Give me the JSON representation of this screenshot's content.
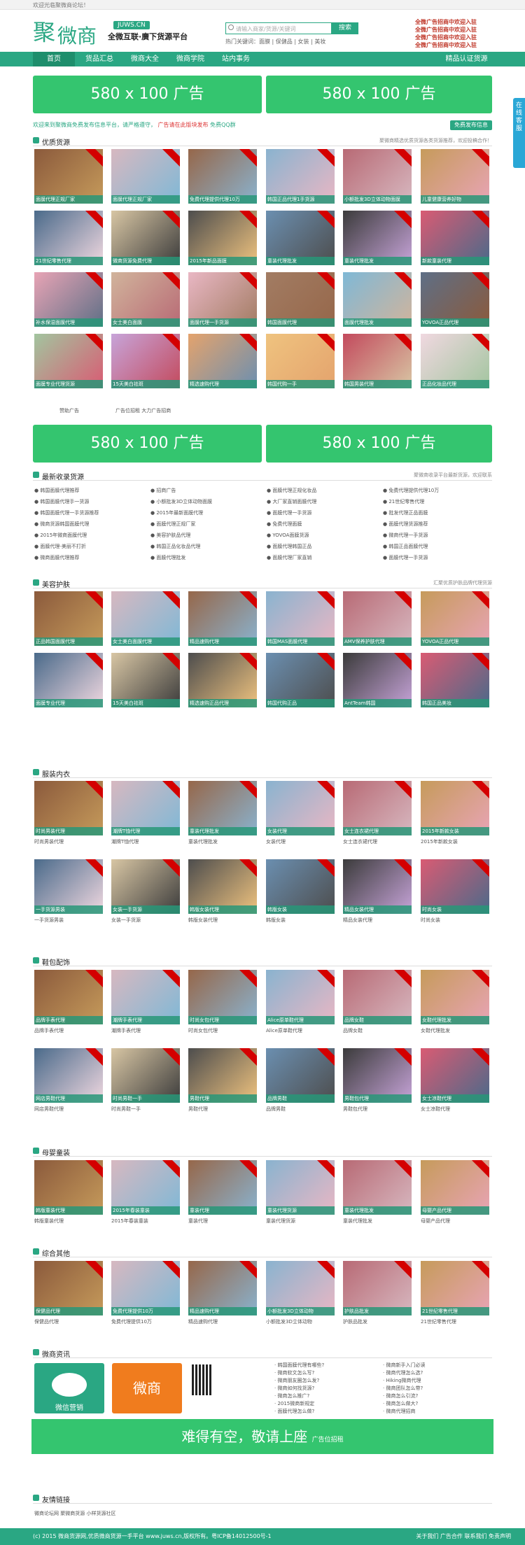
{
  "topbar": {
    "text": "欢迎光临聚微商论坛！"
  },
  "header": {
    "logo_a": "聚",
    "logo_b": "微商",
    "domain": "JUWS.CN",
    "slogan": "全微互联·廣下货源平台",
    "search_placeholder": "请输入商家/货源/关键词",
    "search_button": "搜索",
    "hot": "热门关键词：面膜 | 保健品 | 女装 | 美妆",
    "red_ads": [
      "全微广告招商中欢迎入驻",
      "全微广告招商中欢迎入驻",
      "全微广告招商中欢迎入驻",
      "全微广告招商中欢迎入驻"
    ]
  },
  "nav": [
    "首页",
    "货品汇总",
    "微商大全",
    "微商学院",
    "站内事务",
    "精品认证货源"
  ],
  "banners": [
    "580 x 100 广告",
    "580 x 100 广告"
  ],
  "notice": {
    "a": "欢迎来到聚微商免费发布信息平台，请严格遵守，",
    "b": "广告请在此版块发布",
    "c": "免费QQ群",
    "btn": "免费发布信息"
  },
  "float": "在线客服",
  "sections": {
    "s1": {
      "title": "优质货源",
      "right": "聚微商精选优质货源各类货源推荐，欢迎投稿合作！"
    },
    "s2": {
      "title": "最新收录货源",
      "right": "聚微商收录平台最新货源，欢迎联系"
    },
    "s3": {
      "title": "美容护肤",
      "right": "汇聚优质护肤品牌代理货源"
    },
    "s4": {
      "title": "服装内衣"
    },
    "s5": {
      "title": "鞋包配饰"
    },
    "s6": {
      "title": "母婴童装"
    },
    "s7": {
      "title": "综合其他"
    },
    "s8": {
      "title": "微商资讯"
    },
    "s9": {
      "title": "友情链接"
    }
  },
  "caps1": [
    "面膜代理正规厂家",
    "面膜代理正规厂家",
    "免费代理提供代理10万",
    "韩国正品代理1手货源",
    "小额批发3D立体动物面膜",
    "儿童健康营养好物",
    "21世纪零售代理",
    "微商货源免费代理",
    "2015年新品面膜",
    "童装代理批发",
    "童装代理批发",
    "新款童装代理",
    "补水保湿面膜代理",
    "女士美白面膜",
    "面膜代理一手货源",
    "韩国面膜代理",
    "面膜代理批发",
    "YOVOA正品代理",
    "面膜专业代理货源",
    "15天美白祛斑",
    "精选速购代理",
    "韩国代购一手",
    "韩国男装代理",
    "正品化妆品代理"
  ],
  "caps2": [
    "正品韩国面膜代理",
    "女士美白面膜代理",
    "精品速购代理",
    "韩国MAS面膜代理",
    "AMV保养护肤代理",
    "YOVOA正品代理",
    "面膜专业代理",
    "15天美白祛斑",
    "精选速购正品代理",
    "韩国代购正品",
    "AntTeam韩国",
    "韩国正品美妆"
  ],
  "caps3": [
    "时尚男装代理",
    "潮牌T恤代理",
    "童装代理批发",
    "女装代理",
    "女士连衣裙代理",
    "2015年新款女装",
    "一手货源男装",
    "女装一手货源",
    "韩版女装代理",
    "韩版女装",
    "精品女装代理",
    "时尚女装"
  ],
  "caps4": [
    "品牌手表代理",
    "潮牌手表代理",
    "时尚女包代理",
    "Alice原单鞋代理",
    "品牌女鞋",
    "女鞋代理批发",
    "网店男鞋代理",
    "时尚男鞋一手",
    "男鞋代理",
    "品牌男鞋",
    "男鞋包代理",
    "女士凉鞋代理"
  ],
  "caps5": [
    "韩版童装代理",
    "2015年春装童装",
    "童装代理",
    "童装代理货源",
    "童装代理批发",
    "母婴产品代理"
  ],
  "caps6": [
    "保健品代理",
    "免费代理提供10万",
    "精品速购代理",
    "小额批发3D立体动物",
    "护肤品批发",
    "21世纪零售代理"
  ],
  "labels": {
    "ad1": "赞助广告",
    "ad2": "广告位招租 大力广告招商",
    "links": "微商论坛网 聚微商货源 小样货源社区"
  },
  "news_cols": [
    [
      "韩国面膜代理推荐",
      "韩国面膜代理手一货源",
      "韩国面膜代理一手货源推荐",
      "微商货源韩国面膜代理",
      "2015年微商面膜代理",
      "面膜代理-美丽不打折",
      "微商面膜代理推荐"
    ],
    [
      "招商广告",
      "小额批发3D立体动物面膜",
      "2015年最新面膜代理",
      "面膜代理正规厂家",
      "美容护肤品代理",
      "韩国正品化妆品代理",
      "面膜代理批发"
    ],
    [
      "面膜代理正规化妆品",
      "大厂家直销面膜代理",
      "面膜代理一手货源",
      "免费代理面膜",
      "YOVOA面膜货源",
      "面膜代理韩国正品",
      "面膜代理厂家直销"
    ],
    [
      "免费代理提供代理10万",
      "21世纪零售代理",
      "批发代理正品面膜",
      "面膜代理货源推荐",
      "微商代理一手货源",
      "韩国正品面膜代理",
      "面膜代理一手货源"
    ]
  ],
  "news_feed": [
    "韩国面膜代理有哪些?",
    "微商软文怎么写?",
    "微商朋友圈怎么发?",
    "微商如何找货源?",
    "微商怎么推广?",
    "2015微商新规定",
    "面膜代理怎么做?"
  ],
  "news_feed2": [
    "微商新手入门必读",
    "微商代理怎么选?",
    "Hiking微商代理",
    "微商团队怎么带?",
    "微商怎么引流?",
    "微商怎么做大?",
    "微商代理招商"
  ],
  "wechat_logo": "微商",
  "wechat_card": "微信营销",
  "bigad": "难得有空，敬请上座",
  "bigad_sub": "广告位招租",
  "footer": "(c) 2015 微商货源网,优质微商货源一手平台 www.juws.cn,版权所有。粤ICP备14012500号-1",
  "footer_r": "关于我们 广告合作 联系我们 免责声明",
  "colors": {
    "brand": "#2aa783",
    "banner": "#34c56f",
    "nav_active": "#1e8e6c"
  }
}
